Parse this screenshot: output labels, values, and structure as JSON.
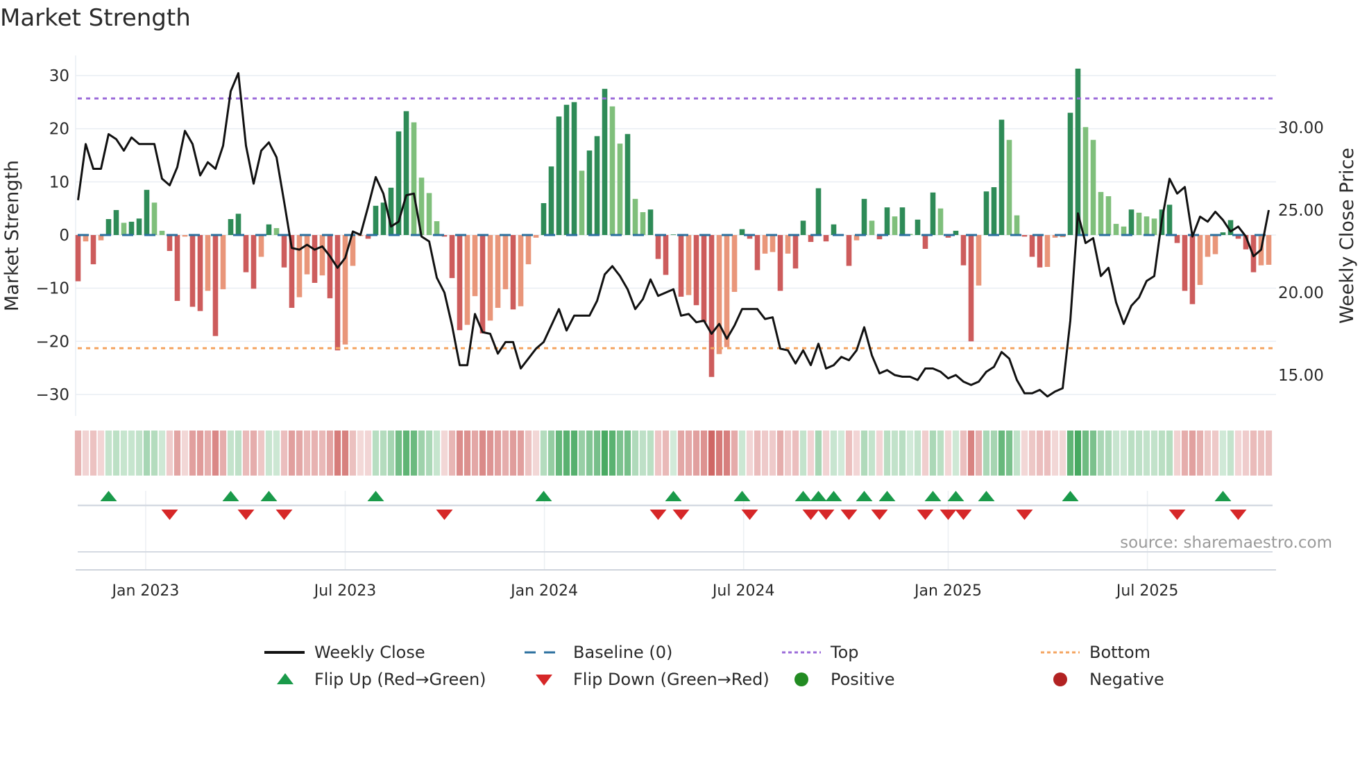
{
  "title": "Market Strength",
  "source": "source: sharemaestro.com",
  "colors": {
    "pos_strong": "#2e8b57",
    "pos_weak": "#7fbf7b",
    "neg_strong": "#cd5c5c",
    "neg_weak": "#e9967a",
    "baseline": "#2a6f9e",
    "top": "#9b6bd9",
    "bottom": "#f4a460",
    "price": "#111111",
    "flip_up": "#1a9a4a",
    "flip_down": "#d62728",
    "positive": "#228b22",
    "negative": "#b22222"
  },
  "legend": [
    {
      "label": "Weekly Close",
      "symbol": "line"
    },
    {
      "label": "Baseline (0)",
      "symbol": "dash"
    },
    {
      "label": "Top",
      "symbol": "dot-purple"
    },
    {
      "label": "Bottom",
      "symbol": "dot-orange"
    },
    {
      "label": "Flip Up (Red→Green)",
      "symbol": "triangle-up"
    },
    {
      "label": "Flip Down (Green→Red)",
      "symbol": "triangle-down"
    },
    {
      "label": "Positive",
      "symbol": "circle-green"
    },
    {
      "label": "Negative",
      "symbol": "circle-red"
    }
  ],
  "chart_data": {
    "type": "bar",
    "title": "Market Strength",
    "ylabel": "Market Strength",
    "y2label": "Weekly Close Price",
    "ylim": [
      -33,
      33
    ],
    "y2lim": [
      13.0,
      34.6
    ],
    "yticks": [
      "30",
      "20",
      "10",
      "0",
      "−10",
      "−20",
      "−30"
    ],
    "ytick_values": [
      30,
      20,
      10,
      0,
      -10,
      -20,
      -30
    ],
    "y2ticks": [
      "30.00",
      "25.00",
      "20.00",
      "15.00"
    ],
    "y2tick_values": [
      30,
      25,
      20,
      15
    ],
    "xticks": [
      "Jan 2023",
      "Jul 2023",
      "Jan 2024",
      "Jul 2024",
      "Jan 2025",
      "Jul 2025"
    ],
    "xtick_week_index": [
      8.86,
      35.0,
      61.1,
      87.2,
      114.0,
      140.1
    ],
    "grid": true,
    "legend_position": "bottom-center",
    "top_level": 25.7,
    "bottom_level": -21.3,
    "baseline": 0,
    "strength": [
      -8.7,
      -1.2,
      -5.5,
      -1,
      3,
      4.7,
      2.3,
      2.5,
      3.1,
      8.5,
      6.1,
      0.8,
      -3,
      -12.4,
      -0.3,
      -13.5,
      -14.3,
      -10.5,
      -19,
      -10.2,
      3,
      4,
      -7,
      -10.1,
      -4.1,
      2,
      1.3,
      -6.1,
      -13.7,
      -11.7,
      -7.4,
      -9,
      -7.6,
      -11.9,
      -21.7,
      -20.6,
      -5.8,
      -0.2,
      -0.7,
      5.5,
      6.1,
      8.9,
      19.5,
      23.3,
      21.2,
      10.8,
      7.9,
      2.6,
      -0.3,
      -8.1,
      -17.9,
      -16.9,
      -11.5,
      -18.5,
      -16.1,
      -13.7,
      -10.2,
      -14,
      -13.4,
      -5.5,
      -0.5,
      6,
      12.9,
      22.3,
      24.5,
      25,
      12.1,
      15.9,
      18.6,
      27.5,
      24.2,
      17.2,
      19,
      6.8,
      4.3,
      4.8,
      -4.5,
      -7.5,
      0.1,
      -11.6,
      -11.3,
      -13.2,
      -16.4,
      -26.7,
      -22.4,
      -21.1,
      -10.7,
      1.1,
      -0.7,
      -6.6,
      -3.5,
      -3.2,
      -10.5,
      -3.5,
      -6.3,
      2.7,
      -1.3,
      8.8,
      -1.2,
      2,
      0.1,
      -5.8,
      -1,
      6.8,
      2.7,
      -0.8,
      5.2,
      3.5,
      5.2,
      0.2,
      2.9,
      -2.6,
      8,
      5,
      -0.5,
      0.8,
      -5.7,
      -20,
      -9.5,
      8.2,
      9,
      21.7,
      17.9,
      3.7,
      -0.3,
      -4.1,
      -6.1,
      -6.0,
      -0.5,
      -0.4,
      23,
      31.3,
      20.3,
      17.9,
      8.1,
      7.3,
      2.1,
      1.6,
      4.8,
      4.2,
      3.5,
      3.1,
      4.8,
      5.7,
      -1.5,
      -10.5,
      -13,
      -9.4,
      -4.1,
      -3.6,
      0.5,
      2.8,
      -0.7,
      -2.7,
      -7,
      -5.7,
      -5.6
    ],
    "weekly_close": [
      25.6,
      29.0,
      27.5,
      27.5,
      29.6,
      29.3,
      28.6,
      29.4,
      29.0,
      29.0,
      29.0,
      26.9,
      26.5,
      27.6,
      29.8,
      29.0,
      27.1,
      27.9,
      27.5,
      28.9,
      32.2,
      33.3,
      28.9,
      26.6,
      28.6,
      29.1,
      28.2,
      25.5,
      22.7,
      22.6,
      22.9,
      22.6,
      22.8,
      22.2,
      21.5,
      22.1,
      23.7,
      23.5,
      25.2,
      27.0,
      26.0,
      24.0,
      24.3,
      25.9,
      26.0,
      23.4,
      23.1,
      20.9,
      20.0,
      18.0,
      15.6,
      15.6,
      18.7,
      17.6,
      17.5,
      16.3,
      17.0,
      17.0,
      15.4,
      16.0,
      16.6,
      17.0,
      18.0,
      19.0,
      17.7,
      18.6,
      18.6,
      18.6,
      19.5,
      21.1,
      21.6,
      21.0,
      20.2,
      19.0,
      19.6,
      20.8,
      19.8,
      20.0,
      20.2,
      18.6,
      18.7,
      18.2,
      18.3,
      17.5,
      18.1,
      17.2,
      18.0,
      19.0,
      19.0,
      19.0,
      18.4,
      18.5,
      16.6,
      16.5,
      15.7,
      16.5,
      15.6,
      16.9,
      15.4,
      15.6,
      16.1,
      15.9,
      16.5,
      17.9,
      16.2,
      15.1,
      15.3,
      15.0,
      14.9,
      14.9,
      14.7,
      15.4,
      15.4,
      15.2,
      14.8,
      15.0,
      14.6,
      14.4,
      14.6,
      15.2,
      15.5,
      16.4,
      16.0,
      14.7,
      13.9,
      13.9,
      14.1,
      13.7,
      14.0,
      14.2,
      18.3,
      24.8,
      23.0,
      23.3,
      21.0,
      21.5,
      19.4,
      18.1,
      19.2,
      19.7,
      20.7,
      21.0,
      24.4,
      26.9,
      26.0,
      26.4,
      23.4,
      24.6,
      24.3,
      24.9,
      24.4,
      23.7,
      24.0,
      23.4,
      22.2,
      22.6,
      25.0
    ],
    "flip_up_weeks": [
      4,
      20,
      25,
      39,
      61,
      78,
      87,
      95,
      97,
      99,
      103,
      106,
      112,
      115,
      119,
      130,
      150
    ],
    "flip_down_weeks": [
      12,
      22,
      27,
      48,
      76,
      79,
      88,
      96,
      98,
      101,
      105,
      111,
      114,
      116,
      124,
      144,
      152
    ]
  }
}
